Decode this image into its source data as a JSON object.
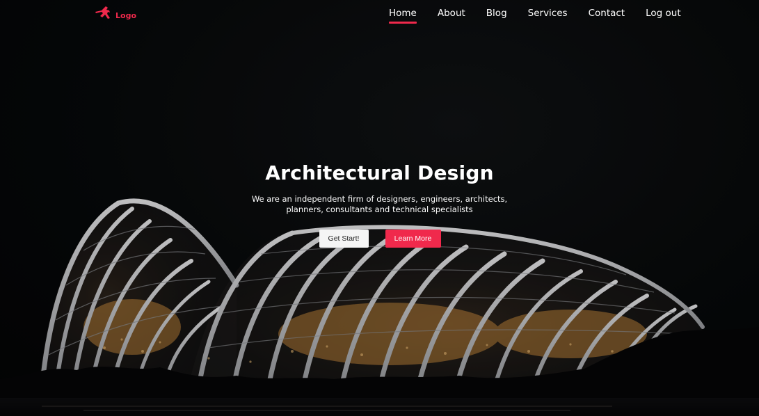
{
  "brand": {
    "logo_text": "Logo",
    "accent_color": "#f0294c"
  },
  "nav": {
    "items": [
      {
        "label": "Home",
        "active": true
      },
      {
        "label": "About",
        "active": false
      },
      {
        "label": "Blog",
        "active": false
      },
      {
        "label": "Services",
        "active": false
      },
      {
        "label": "Contact",
        "active": false
      },
      {
        "label": "Log out",
        "active": false
      }
    ]
  },
  "hero": {
    "title": "Architectural Design",
    "subtitle": "We are an independent firm of designers, engineers, architects, planners, consultants and technical specialists",
    "primary_button": "Get Start!",
    "secondary_button": "Learn More"
  },
  "background": {
    "subject": "illuminated-arched-glass-dome-building-at-night"
  }
}
